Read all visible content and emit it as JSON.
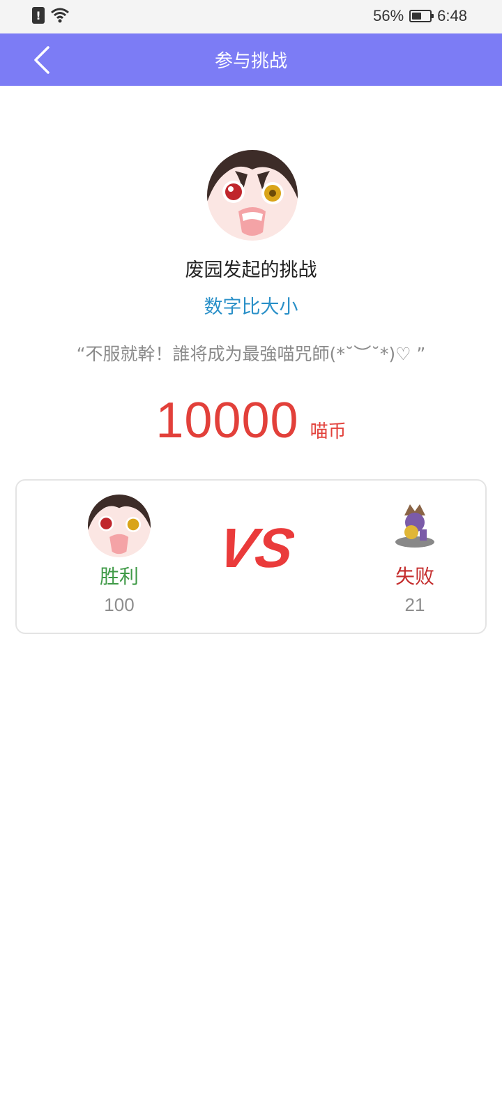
{
  "status_bar": {
    "battery_percent": "56%",
    "battery_level": 0.56,
    "time": "6:48"
  },
  "header": {
    "title": "参与挑战"
  },
  "challenge": {
    "creator_line": "废园发起的挑战",
    "game_name": "数字比大小",
    "quote": "“不服就幹！誰将成为最強喵咒師(*˘︶˘*)♡ ”",
    "amount": "10000",
    "unit": "喵币"
  },
  "battle": {
    "vs_label": "VS",
    "left": {
      "result": "胜利",
      "score": "100"
    },
    "right": {
      "result": "失败",
      "score": "21"
    }
  },
  "colors": {
    "header_bg": "#7c7cf5",
    "amount": "#e2403a",
    "game_name": "#2a90c8",
    "win": "#3f9a47",
    "lose": "#c42b2b",
    "vs": "#ea3b3b"
  }
}
